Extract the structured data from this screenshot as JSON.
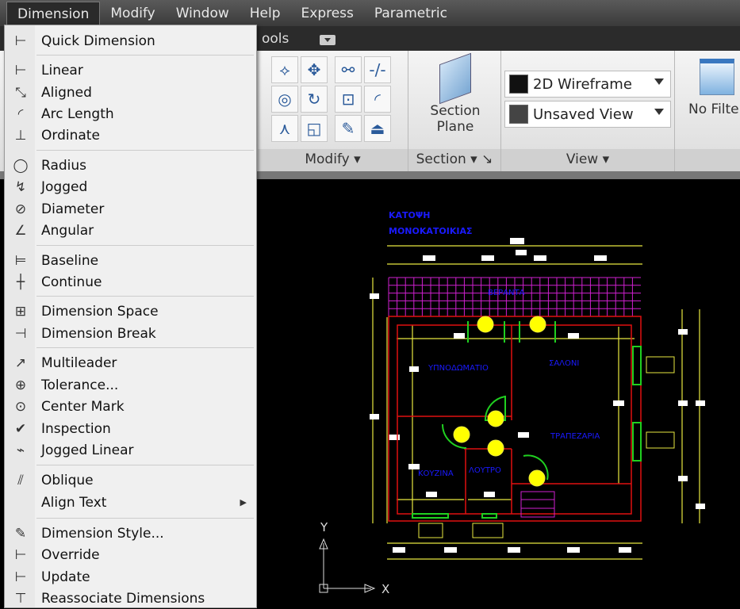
{
  "menubar": {
    "items": [
      "Dimension",
      "Modify",
      "Window",
      "Help",
      "Express",
      "Parametric"
    ]
  },
  "tabbar": {
    "partial_tab": "ools"
  },
  "ribbon": {
    "panels": {
      "modify": "Modify",
      "section": "Section",
      "view": "View"
    },
    "section_plane": {
      "line1": "Section",
      "line2": "Plane"
    },
    "visual_style": "2D Wireframe",
    "named_view": "Unsaved View",
    "filter": "No Filte"
  },
  "menu": {
    "items": [
      {
        "label": "Quick Dimension",
        "icon": "quick-dimension-icon",
        "glyph": "⊢"
      },
      {
        "label": "Linear",
        "icon": "linear-icon",
        "glyph": "⊢"
      },
      {
        "label": "Aligned",
        "icon": "aligned-icon",
        "glyph": "⤡"
      },
      {
        "label": "Arc Length",
        "icon": "arc-length-icon",
        "glyph": "◜"
      },
      {
        "label": "Ordinate",
        "icon": "ordinate-icon",
        "glyph": "⊥"
      },
      {
        "label": "Radius",
        "icon": "radius-icon",
        "glyph": "◯"
      },
      {
        "label": "Jogged",
        "icon": "jogged-icon",
        "glyph": "↯"
      },
      {
        "label": "Diameter",
        "icon": "diameter-icon",
        "glyph": "⊘"
      },
      {
        "label": "Angular",
        "icon": "angular-icon",
        "glyph": "∠"
      },
      {
        "label": "Baseline",
        "icon": "baseline-icon",
        "glyph": "⊨"
      },
      {
        "label": "Continue",
        "icon": "continue-icon",
        "glyph": "┼"
      },
      {
        "label": "Dimension Space",
        "icon": "dimension-space-icon",
        "glyph": "⊞"
      },
      {
        "label": "Dimension Break",
        "icon": "dimension-break-icon",
        "glyph": "⊣"
      },
      {
        "label": "Multileader",
        "icon": "multileader-icon",
        "glyph": "↗"
      },
      {
        "label": "Tolerance...",
        "icon": "tolerance-icon",
        "glyph": "⊕"
      },
      {
        "label": "Center Mark",
        "icon": "center-mark-icon",
        "glyph": "⊙"
      },
      {
        "label": "Inspection",
        "icon": "inspection-icon",
        "glyph": "✔"
      },
      {
        "label": "Jogged Linear",
        "icon": "jogged-linear-icon",
        "glyph": "⌁"
      },
      {
        "label": "Oblique",
        "icon": "oblique-icon",
        "glyph": "⫽"
      },
      {
        "label": "Align Text",
        "icon": "",
        "glyph": "",
        "submenu": "▶"
      },
      {
        "label": "Dimension Style...",
        "icon": "dimension-style-icon",
        "glyph": "✎"
      },
      {
        "label": "Override",
        "icon": "override-icon",
        "glyph": "⊢"
      },
      {
        "label": "Update",
        "icon": "update-icon",
        "glyph": "⊢"
      },
      {
        "label": "Reassociate Dimensions",
        "icon": "reassociate-icon",
        "glyph": "⊤"
      }
    ]
  },
  "drawing": {
    "title1": "ΚΑΤΟΨΗ",
    "title2": "ΜΟΝΟΚΑΤΟΙΚΙΑΣ",
    "rooms": {
      "veranda": "ΒΕΡΑΝΤΑ",
      "bedroom": "ΥΠΝΟΔΩΜΑΤΙΟ",
      "living": "ΣΑΛΟΝΙ",
      "dining": "ΤΡΑΠΕΖΑΡΙΑ",
      "kitchen": "ΚΟΥΖΙΝΑ",
      "bath": "ΛΟΥΤΡΟ"
    },
    "axis_x": "X",
    "axis_y": "Y"
  },
  "colors": {
    "wall": "#e01010",
    "dim": "#e8e840",
    "grid": "#d020d0",
    "door": "#20d020",
    "text": "#1a1aff"
  }
}
